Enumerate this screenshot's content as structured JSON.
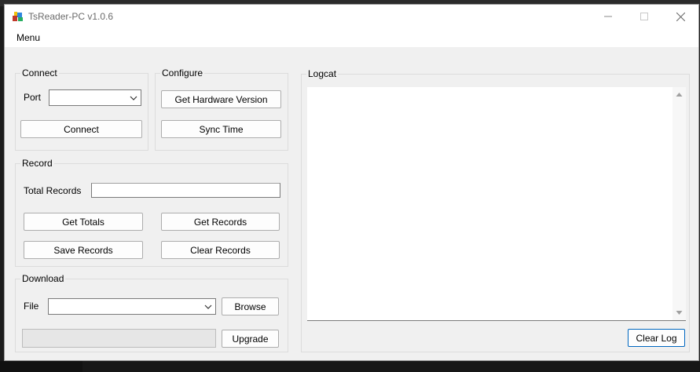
{
  "window": {
    "title": "TsReader-PC v1.0.6"
  },
  "menu": {
    "items": [
      "Menu"
    ]
  },
  "connect": {
    "group_label": "Connect",
    "port_label": "Port",
    "port_value": "",
    "connect_button": "Connect"
  },
  "configure": {
    "group_label": "Configure",
    "hardware_button": "Get Hardware Version",
    "sync_button": "Sync Time"
  },
  "record": {
    "group_label": "Record",
    "total_label": "Total Records",
    "total_value": "",
    "get_totals_button": "Get Totals",
    "get_records_button": "Get Records",
    "save_records_button": "Save Records",
    "clear_records_button": "Clear Records"
  },
  "download": {
    "group_label": "Download",
    "file_label": "File",
    "file_value": "",
    "browse_button": "Browse",
    "upgrade_button": "Upgrade",
    "progress": 0
  },
  "logcat": {
    "group_label": "Logcat",
    "content": "",
    "clear_button": "Clear Log"
  },
  "colors": {
    "accent": "#0067c0",
    "window_bg": "#f0f0f0",
    "titlebar_bg": "#ffffff"
  }
}
